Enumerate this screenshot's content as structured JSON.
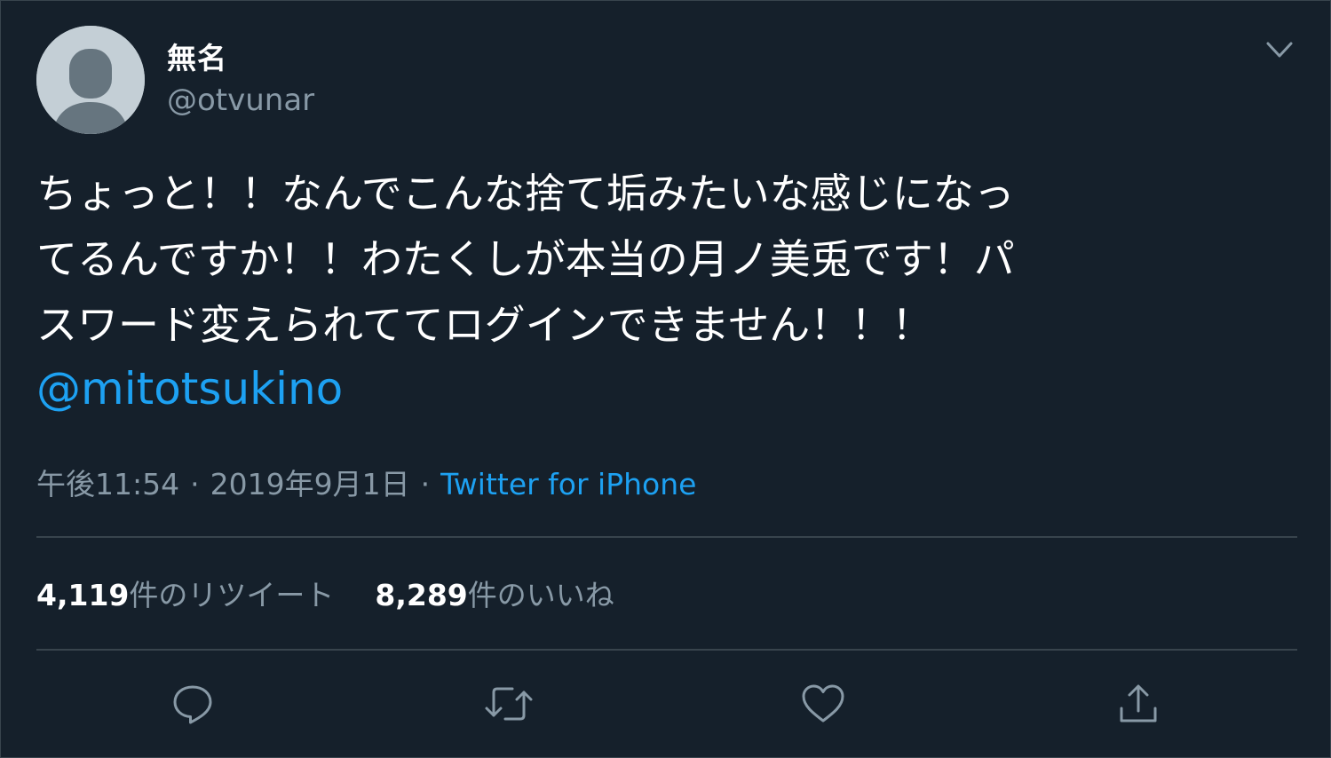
{
  "author": {
    "display_name": "無名",
    "handle": "@otvunar",
    "avatar_icon": "default-profile-icon"
  },
  "menu": {
    "icon": "chevron-down-icon"
  },
  "tweet": {
    "lines": [
      "ちょっと！！なんでこんな捨て垢みたいな感じになっ",
      "てるんですか！！わたくしが本当の月ノ美兎です！パ",
      "スワード変えられててログインできません！！！"
    ],
    "mention": "@mitotsukino"
  },
  "meta": {
    "time": "午後11:54",
    "separator": "·",
    "date": "2019年9月1日",
    "source": "Twitter for iPhone"
  },
  "stats": {
    "retweets_count": "4,119",
    "retweets_label": "件のリツイート",
    "likes_count": "8,289",
    "likes_label": "件のいいね"
  },
  "actions": [
    {
      "name": "reply",
      "icon": "reply-icon"
    },
    {
      "name": "retweet",
      "icon": "retweet-icon"
    },
    {
      "name": "like",
      "icon": "heart-icon"
    },
    {
      "name": "share",
      "icon": "share-icon"
    }
  ],
  "colors": {
    "background": "#15202b",
    "text": "#ffffff",
    "secondary_text": "#8899a6",
    "accent": "#1da1f2",
    "divider": "#38444d"
  }
}
